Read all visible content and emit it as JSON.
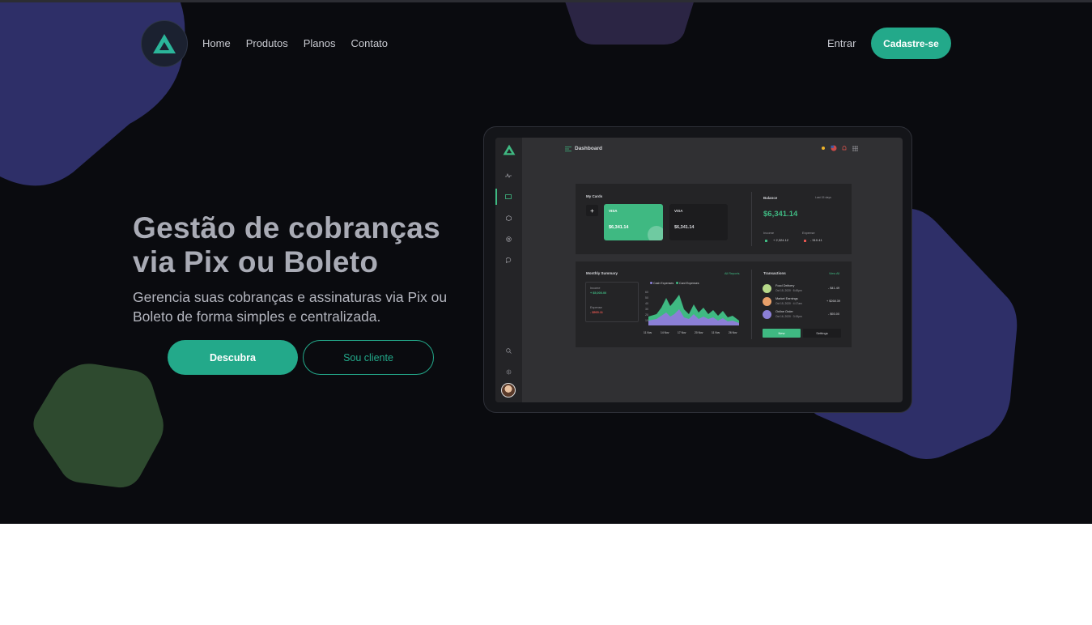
{
  "nav": {
    "logo_icon": "triangle-logo-icon",
    "links": [
      "Home",
      "Produtos",
      "Planos",
      "Contato"
    ],
    "login": "Entrar",
    "signup": "Cadastre-se"
  },
  "hero": {
    "title_line1": "Gestão de cobranças",
    "title_line2": "via Pix ou Boleto",
    "subtitle": "Gerencia suas cobranças e assinaturas via Pix ou Boleto de forma simples e centralizada.",
    "primary_button": "Descubra",
    "secondary_button": "Sou cliente"
  },
  "colors": {
    "accent": "#23a98a",
    "hero_bg": "#0a0b0f",
    "blob_indigo": "#2e2f68",
    "blob_green": "#2e4a2f",
    "blob_purple": "#2b2544"
  },
  "dashboard": {
    "title": "Dashboard",
    "cards_title": "My Cards",
    "card1_brand": "VISA",
    "card1_amount": "$6,341.14",
    "card2_brand": "VISA",
    "card2_amount": "$6,341.14",
    "balance_label": "Balance",
    "period": "Last 15 days",
    "balance_value": "$6,341.14",
    "income_label": "Income",
    "income_value": "+ 2,324.12",
    "expense_label": "Expense",
    "expense_value": "- 510.41",
    "summary_title": "Monthly Summary",
    "all_reports": "All Reports",
    "legend_cash": "Cash Expenses",
    "legend_card": "Card Expenses",
    "summary_income_label": "Income",
    "summary_income_value": "+ $5,000.00",
    "summary_expense_label": "Expense",
    "summary_expense_value": "- $565.11",
    "y_ticks": [
      "60",
      "50",
      "40",
      "30",
      "20",
      "10"
    ],
    "x_ticks": [
      "11 Nov",
      "14 Nov",
      "17 Nov",
      "20 Nov",
      "11 Nov",
      "26 Nov"
    ],
    "transactions_title": "Transactions",
    "view_all": "View All",
    "transactions": [
      {
        "name": "Food Delivery",
        "date": "Oct 15, 2020 · 8:45pm",
        "amount": "- $41.49"
      },
      {
        "name": "Market Earnings",
        "date": "Oct 15, 2020 · 4:17am",
        "amount": "+ $268.39"
      },
      {
        "name": "Online Order",
        "date": "Oct 16, 2020 · 3:15pm",
        "amount": "- $93.00"
      }
    ],
    "btn_new": "New",
    "btn_settings": "Settings"
  }
}
